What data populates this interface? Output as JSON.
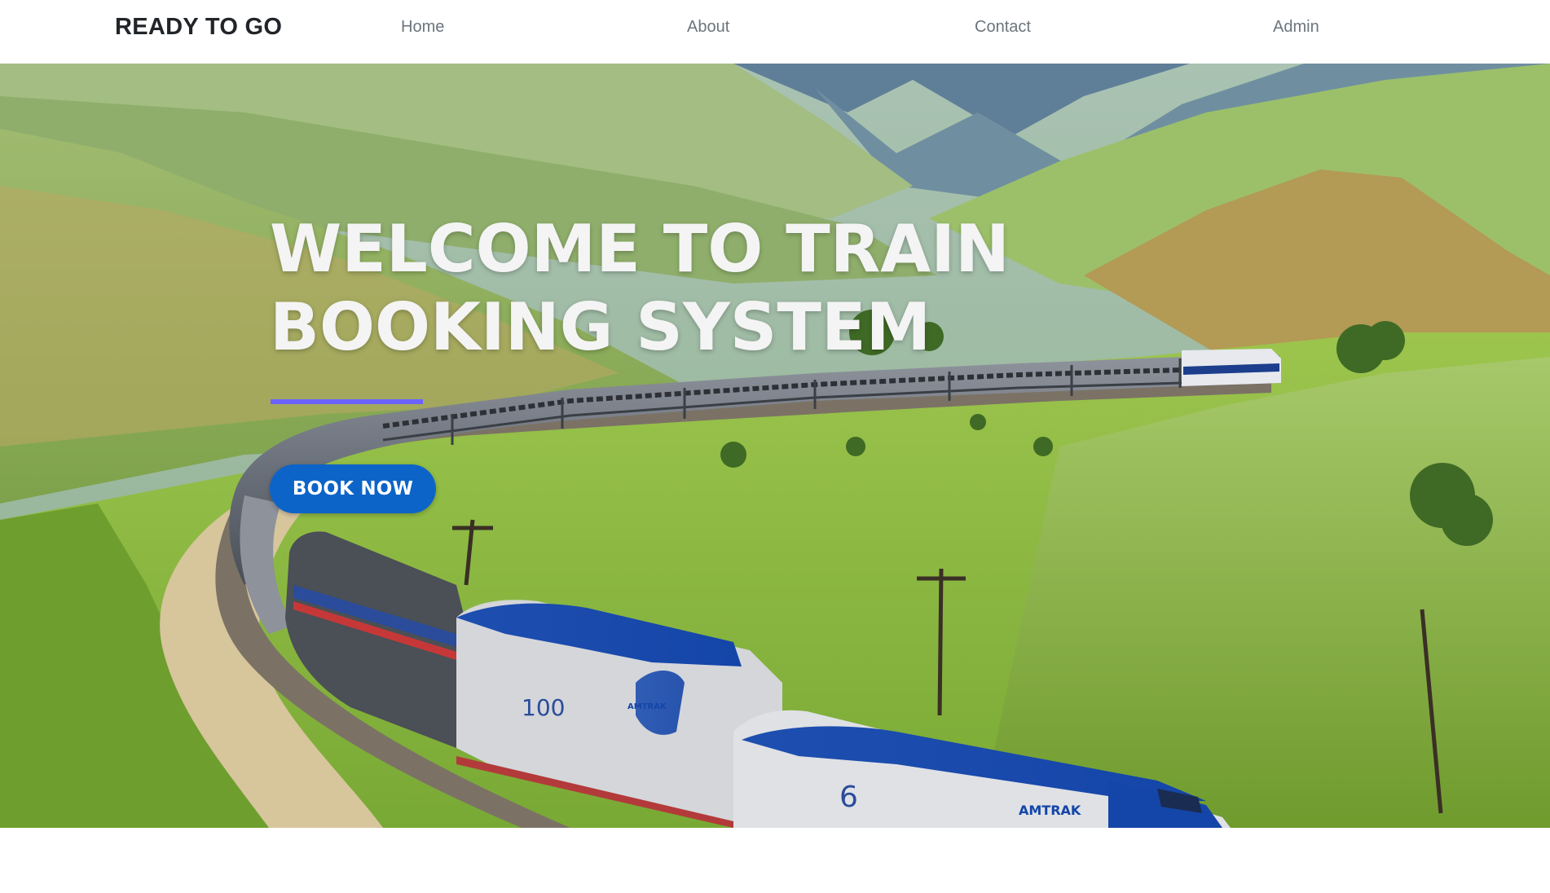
{
  "navbar": {
    "brand": "READY TO GO",
    "links": [
      "Home",
      "About",
      "Contact",
      "Admin"
    ]
  },
  "hero": {
    "title": "WELCOME TO TRAIN BOOKING SYSTEM",
    "button_label": "BOOK NOW",
    "image_labels": {
      "loco_number_1": "100",
      "loco_number_2": "6",
      "loco_logo": "AMTRAK"
    }
  },
  "colors": {
    "accent_underline": "#6c63ff",
    "button": "#0d64c8",
    "title_text": "#f4f4f4",
    "brand_text": "#212529",
    "nav_text": "#6c757d"
  },
  "icons": [
    "hero-background-image"
  ]
}
